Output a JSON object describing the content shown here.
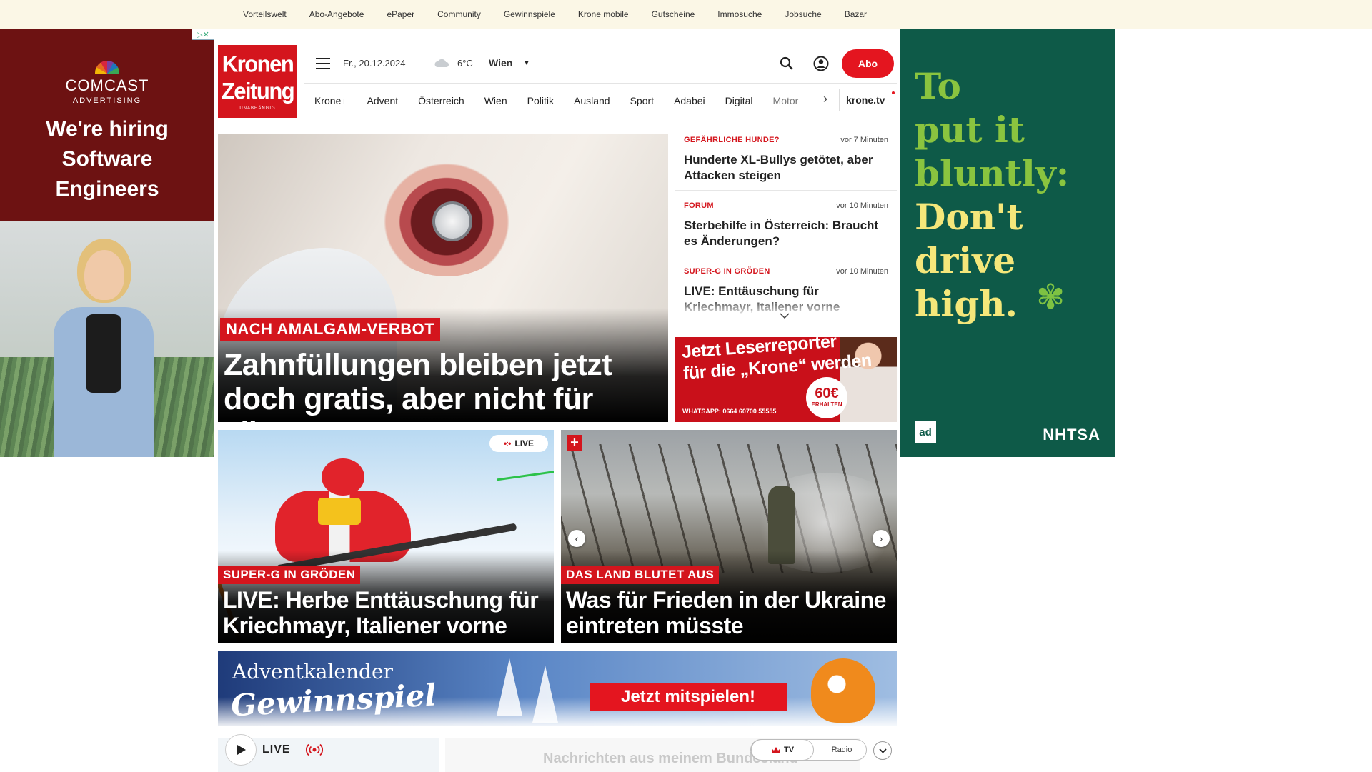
{
  "topbar": {
    "links": [
      "Vorteilswelt",
      "Abo-Angebote",
      "ePaper",
      "Community",
      "Gewinnspiele",
      "Krone mobile",
      "Gutscheine",
      "Immosuche",
      "Jobsuche",
      "Bazar"
    ]
  },
  "ad_left": {
    "adchoices": "▷✕",
    "brand_name": "COMCAST",
    "brand_sub": "ADVERTISING",
    "headline_lines": [
      "We're hiring",
      "Software",
      "Engineers"
    ]
  },
  "ad_right": {
    "lines": [
      "To",
      "put it",
      "bluntly:",
      "Don't",
      "drive",
      "high."
    ],
    "leaf": "✾",
    "sponsor_left": "ad",
    "sponsor_right": "NHTSA"
  },
  "logo": {
    "line1": "Kronen",
    "line2": "Zeitung",
    "line3": "UNABHÄNGIG"
  },
  "header": {
    "date": "Fr., 20.12.2024",
    "temperature": "6°C",
    "city": "Wien",
    "abo_label": "Abo"
  },
  "nav": {
    "items": [
      "Krone+",
      "Advent",
      "Österreich",
      "Wien",
      "Politik",
      "Ausland",
      "Sport",
      "Adabei",
      "Digital"
    ],
    "overflow_item": "Motor",
    "tv_label": "krone.tv"
  },
  "hero": {
    "kicker": "NACH AMALGAM-VERBOT",
    "title": "Zahnfüllungen bleiben jetzt doch gratis, aber nicht für alle!"
  },
  "ticker": [
    {
      "kicker": "GEFÄHRLICHE HUNDE?",
      "time": "vor 7 Minuten",
      "title": "Hunderte XL-Bullys getötet, aber Attacken steigen"
    },
    {
      "kicker": "FORUM",
      "time": "vor 10 Minuten",
      "title": "Sterbehilfe in Österreich: Braucht es Änderungen?"
    },
    {
      "kicker": "SUPER-G IN GRÖDEN",
      "time": "vor 10 Minuten",
      "title": "LIVE: Enttäuschung für Kriechmayr, Italiener vorne"
    }
  ],
  "reporter_ad": {
    "line1": "Jetzt Leserreporter",
    "line2": "für die „Krone“ werden",
    "whatsapp": "WHATSAPP: 0664 60700 55555",
    "badge_amount": "60€",
    "badge_sub": "ERHALTEN"
  },
  "cards": [
    {
      "kicker": "SUPER-G IN GRÖDEN",
      "title": "LIVE: Herbe Enttäuschung für Kriechmayr, Italiener vorne",
      "badge": "LIVE"
    },
    {
      "kicker": "DAS LAND BLUTET AUS",
      "title": "Was für Frieden in der Ukraine eintreten müsste",
      "badge": "+"
    }
  ],
  "advent_banner": {
    "line1": "Adventkalender",
    "line2": "Gewinnspiel",
    "cta": "Jetzt mitspielen!"
  },
  "player": {
    "live_label": "LIVE",
    "tv_label": "TV",
    "radio_label": "Radio",
    "background_text": "Nachrichten aus meinem Bundesland"
  },
  "colors": {
    "brand_red": "#d4151d",
    "topbar_bg": "#fbf7e6",
    "ad_right_bg": "#0e5a48",
    "ad_left_bg": "#6d1212"
  }
}
